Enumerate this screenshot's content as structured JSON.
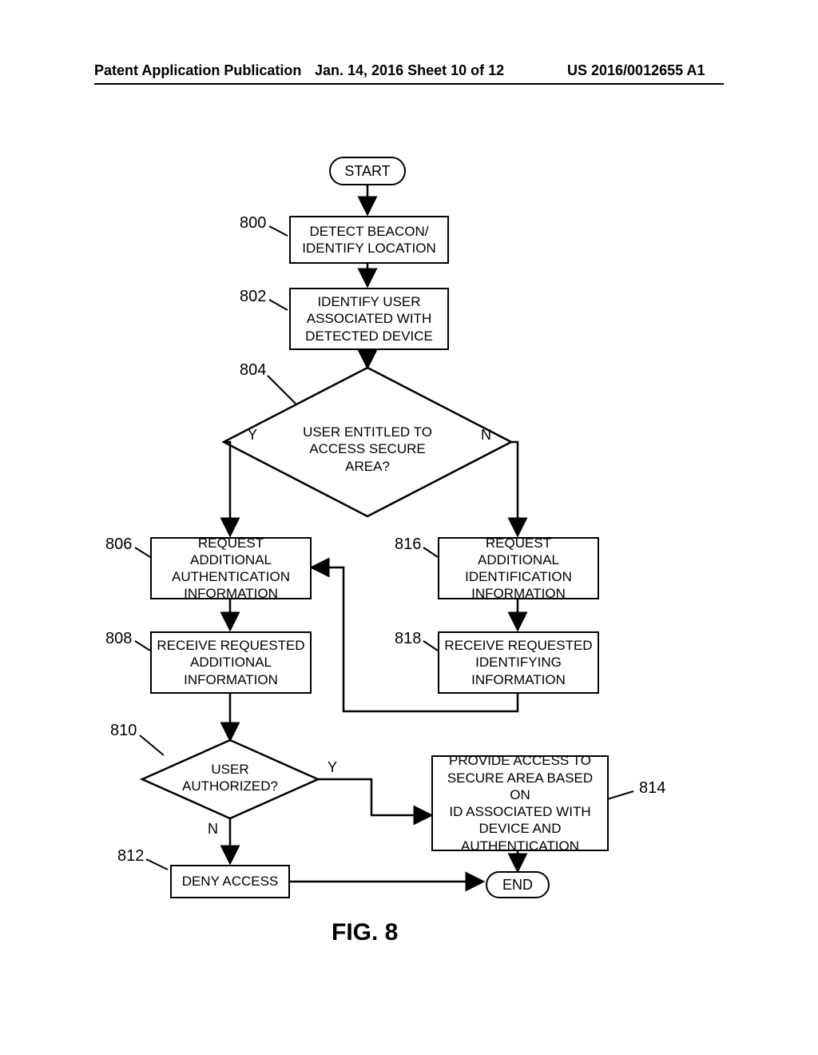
{
  "header": {
    "left": "Patent Application Publication",
    "center": "Jan. 14, 2016  Sheet 10 of 12",
    "right": "US 2016/0012655 A1"
  },
  "figure_caption": "FIG. 8",
  "terminators": {
    "start": "START",
    "end": "END"
  },
  "steps": {
    "s800": "DETECT BEACON/\nIDENTIFY LOCATION",
    "s802": "IDENTIFY USER\nASSOCIATED WITH\nDETECTED DEVICE",
    "s804": "USER ENTITLED TO\nACCESS SECURE AREA?",
    "s806": "REQUEST ADDITIONAL\nAUTHENTICATION\nINFORMATION",
    "s808": "RECEIVE REQUESTED\nADDITIONAL\nINFORMATION",
    "s810": "USER\nAUTHORIZED?",
    "s812": "DENY ACCESS",
    "s814": "PROVIDE ACCESS TO\nSECURE AREA BASED ON\nID ASSOCIATED WITH\nDEVICE AND\nAUTHENTICATION",
    "s816": "REQUEST ADDITIONAL\nIDENTIFICATION\nINFORMATION",
    "s818": "RECEIVE REQUESTED\nIDENTIFYING\nINFORMATION"
  },
  "branches": {
    "yes": "Y",
    "no": "N"
  },
  "refs": {
    "r800": "800",
    "r802": "802",
    "r804": "804",
    "r806": "806",
    "r808": "808",
    "r810": "810",
    "r812": "812",
    "r814": "814",
    "r816": "816",
    "r818": "818"
  }
}
